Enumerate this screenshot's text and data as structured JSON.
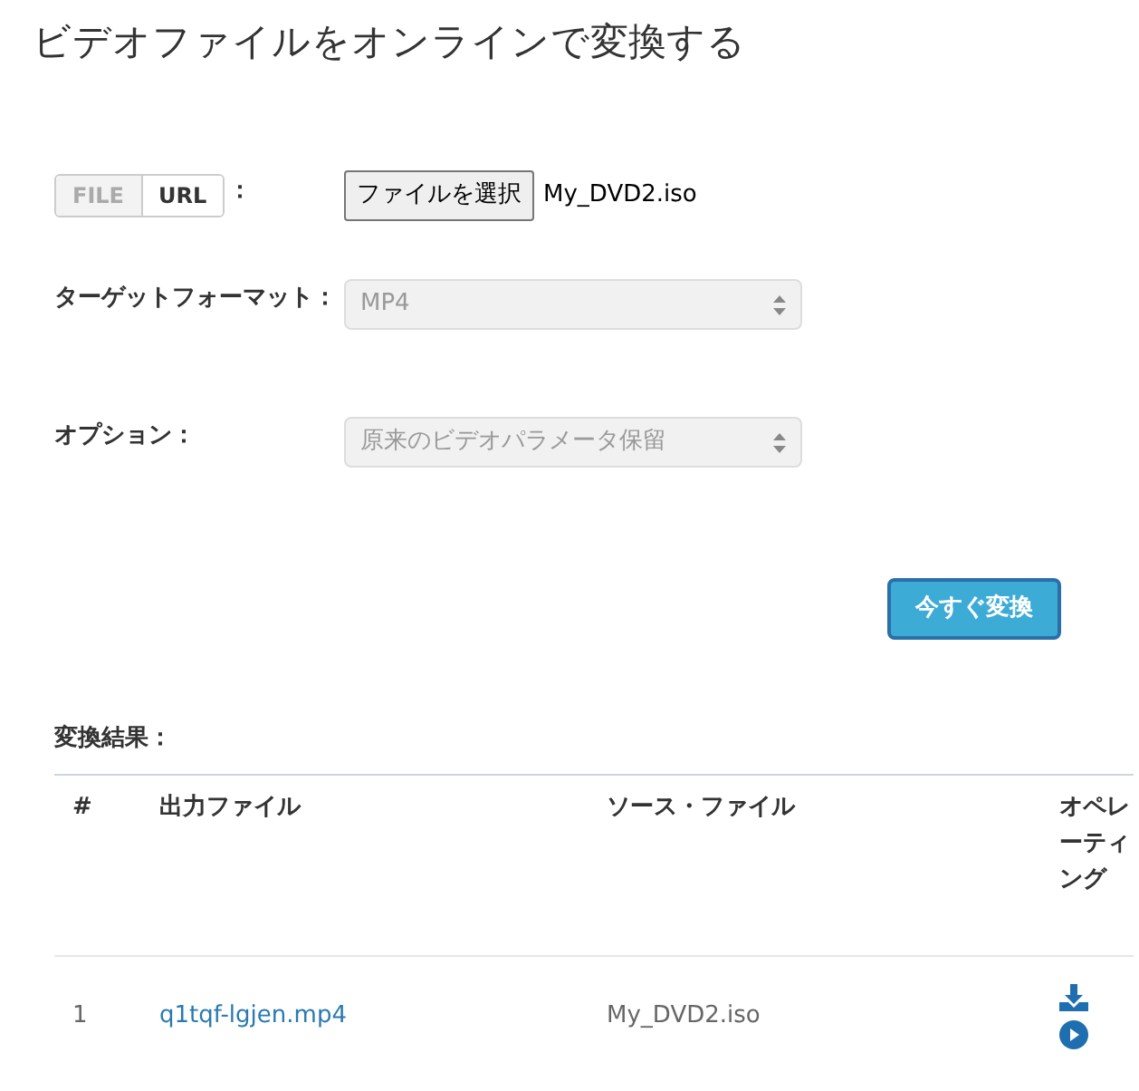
{
  "title": "ビデオファイルをオンラインで変換する",
  "source": {
    "modes": [
      {
        "label": "FILE",
        "selected": true
      },
      {
        "label": "URL",
        "selected": false
      }
    ],
    "colon": "：",
    "choose_button": "ファイルを選択",
    "file_name": "My_DVD2.iso"
  },
  "fields": [
    {
      "label": "ターゲットフォーマット：",
      "value": "MP4"
    },
    {
      "label": "オプション：",
      "value": "原来のビデオパラメータ保留"
    }
  ],
  "convert_button": "今すぐ変換",
  "results": {
    "title": "変換結果：",
    "columns": [
      "#",
      "出力ファイル",
      "ソース・ファイル",
      "オペレーティング"
    ],
    "rows": [
      {
        "index": "1",
        "output": "q1tqf-lgjen.mp4",
        "source": "My_DVD2.iso"
      }
    ]
  }
}
